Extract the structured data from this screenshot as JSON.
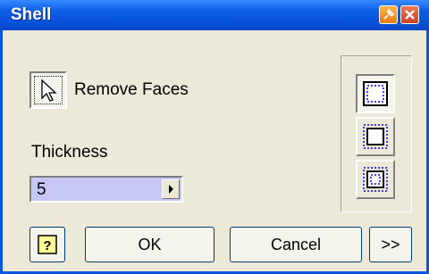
{
  "window": {
    "title": "Shell"
  },
  "faces": {
    "label": "Remove Faces"
  },
  "thickness": {
    "label": "Thickness",
    "value": "5"
  },
  "buttons": {
    "ok": "OK",
    "cancel": "Cancel",
    "more": ">>"
  },
  "colors": {
    "titlebar": "#0853D9",
    "face": "#ECE9D8",
    "field": "#C6C7F7",
    "icon_blue": "#0000FF"
  },
  "icons": {
    "pin": "pin-icon",
    "close": "close-icon",
    "select": "cursor-arrow-icon",
    "help": "help-icon"
  }
}
